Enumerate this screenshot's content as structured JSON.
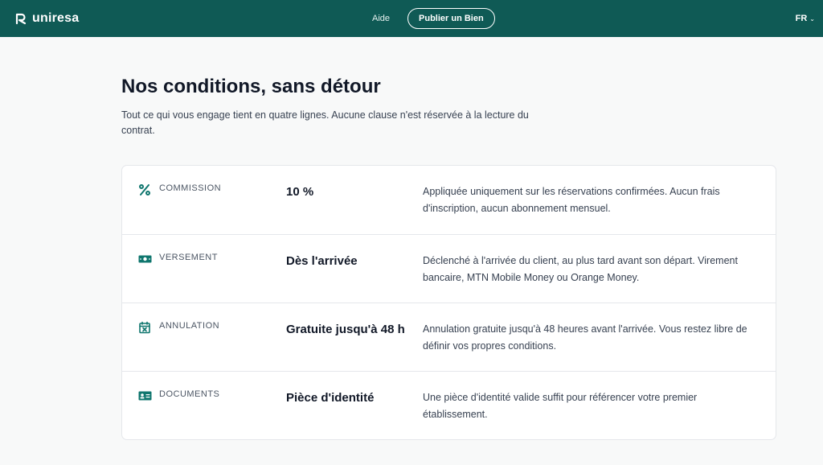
{
  "header": {
    "brand": "uniresa",
    "nav_help": "Aide",
    "publish_button": "Publier un Bien",
    "language": "FR",
    "colors": {
      "bar": "#0f5a55",
      "accent": "#0f766e"
    }
  },
  "page": {
    "title": "Nos conditions, sans détour",
    "subtitle": "Tout ce qui vous engage tient en quatre lignes. Aucune clause n'est réservée à la lecture du contrat."
  },
  "conditions": [
    {
      "icon": "percent-icon",
      "label": "COMMISSION",
      "value": "10 %",
      "description": "Appliquée uniquement sur les réservations confirmées. Aucun frais d'inscription, aucun abonnement mensuel."
    },
    {
      "icon": "banknote-icon",
      "label": "VERSEMENT",
      "value": "Dès l'arrivée",
      "description": "Déclenché à l'arrivée du client, au plus tard avant son départ. Virement bancaire, MTN Mobile Money ou Orange Money."
    },
    {
      "icon": "calendar-x-icon",
      "label": "ANNULATION",
      "value": "Gratuite jusqu'à 48 h",
      "description": "Annulation gratuite jusqu'à 48 heures avant l'arrivée. Vous restez libre de définir vos propres conditions."
    },
    {
      "icon": "id-card-icon",
      "label": "DOCUMENTS",
      "value": "Pièce d'identité",
      "description": "Une pièce d'identité valide suffit pour référencer votre premier établissement."
    }
  ]
}
